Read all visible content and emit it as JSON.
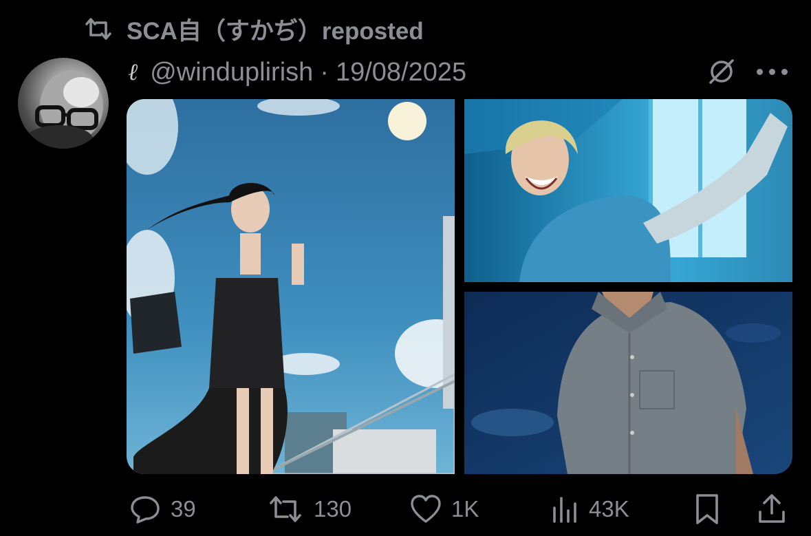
{
  "repost": {
    "icon": "repost-icon",
    "text": "SCA自（すかぢ）reposted"
  },
  "author": {
    "avatar": "avatar",
    "name_glyph": "ℓ",
    "handle": "@winduplirish",
    "separator": "·",
    "date": "19/08/2025"
  },
  "header_icons": [
    "no-reply-icon",
    "more-icon"
  ],
  "media": [
    {
      "name": "photo-girl-black-dress"
    },
    {
      "name": "photo-blonde-man-laughing"
    },
    {
      "name": "photo-man-grey-shirt"
    }
  ],
  "actions": {
    "reply": {
      "icon": "reply-icon",
      "count": "39"
    },
    "repost": {
      "icon": "repost-icon",
      "count": "130"
    },
    "like": {
      "icon": "heart-icon",
      "count": "1K"
    },
    "views": {
      "icon": "views-icon",
      "count": "43K"
    },
    "bookmark": {
      "icon": "bookmark-icon"
    },
    "share": {
      "icon": "share-icon"
    }
  },
  "colors": {
    "background": "#000000",
    "muted_text": "#8b8f94",
    "text": "#e7e9ea"
  }
}
